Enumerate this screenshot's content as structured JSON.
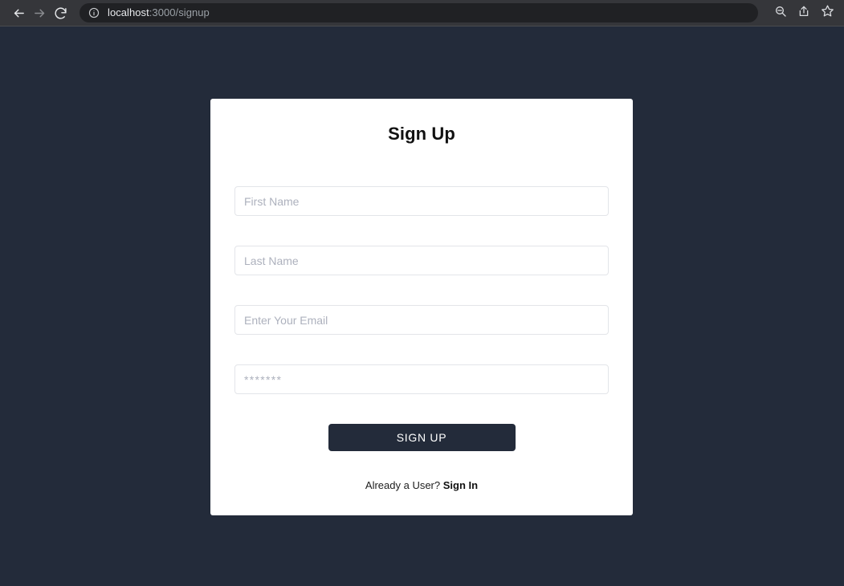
{
  "browser": {
    "back_icon": "back-arrow-icon",
    "forward_icon": "forward-arrow-icon",
    "reload_icon": "reload-icon",
    "site_info_icon": "info-circle-icon",
    "url_host": "localhost",
    "url_path": ":3000/signup",
    "url_full": "localhost:3000/signup",
    "actions": {
      "zoom_out_icon": "zoom-out-magnifier-icon",
      "share_icon": "share-icon",
      "bookmark_icon": "star-bookmark-icon"
    }
  },
  "colors": {
    "page_background": "#232b3a",
    "card_background": "#ffffff",
    "button_background": "#232b3a",
    "button_text": "#ffffff",
    "input_border": "#e3e5e9",
    "placeholder_text": "#adb1bd",
    "chrome_background": "#35363a",
    "url_pill_background": "#202124"
  },
  "card": {
    "title": "Sign Up",
    "fields": [
      {
        "name": "first-name",
        "placeholder": "First Name",
        "value": "",
        "type": "text"
      },
      {
        "name": "last-name",
        "placeholder": "Last Name",
        "value": "",
        "type": "text"
      },
      {
        "name": "email",
        "placeholder": "Enter Your Email",
        "value": "",
        "type": "text"
      },
      {
        "name": "password",
        "placeholder": "*******",
        "value": "",
        "type": "text"
      }
    ],
    "submit_label": "SIGN UP",
    "footer_text": "Already a User?",
    "footer_link": "Sign In"
  }
}
